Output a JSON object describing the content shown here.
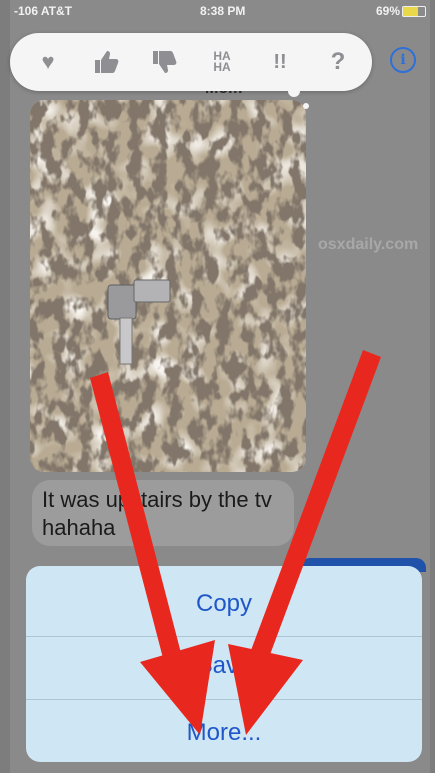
{
  "status_bar": {
    "carrier": "-106 AT&T",
    "time": "8:38 PM",
    "battery": "69%",
    "battery_level": 0.69
  },
  "tapback": {
    "reactions": [
      {
        "icon": "heart-icon",
        "glyph": "♥"
      },
      {
        "icon": "thumbs-up-icon",
        "glyph": "👍"
      },
      {
        "icon": "thumbs-down-icon",
        "glyph": "👎"
      },
      {
        "icon": "haha-icon",
        "line1": "HA",
        "line2": "HA"
      },
      {
        "icon": "exclamation-icon",
        "glyph": "!!"
      },
      {
        "icon": "question-icon",
        "glyph": "?"
      }
    ]
  },
  "header": {
    "sender": "Mom",
    "info_icon": "info-icon"
  },
  "watermark": "osxdaily.com",
  "message": {
    "text": "It was upstairs by the tv hahaha"
  },
  "action_sheet": {
    "copy": "Copy",
    "save": "Save",
    "more": "More..."
  },
  "colors": {
    "accent": "#1f57c9",
    "annotation_arrow": "#e8281e",
    "sheet_bg": "#cfe7f4"
  }
}
